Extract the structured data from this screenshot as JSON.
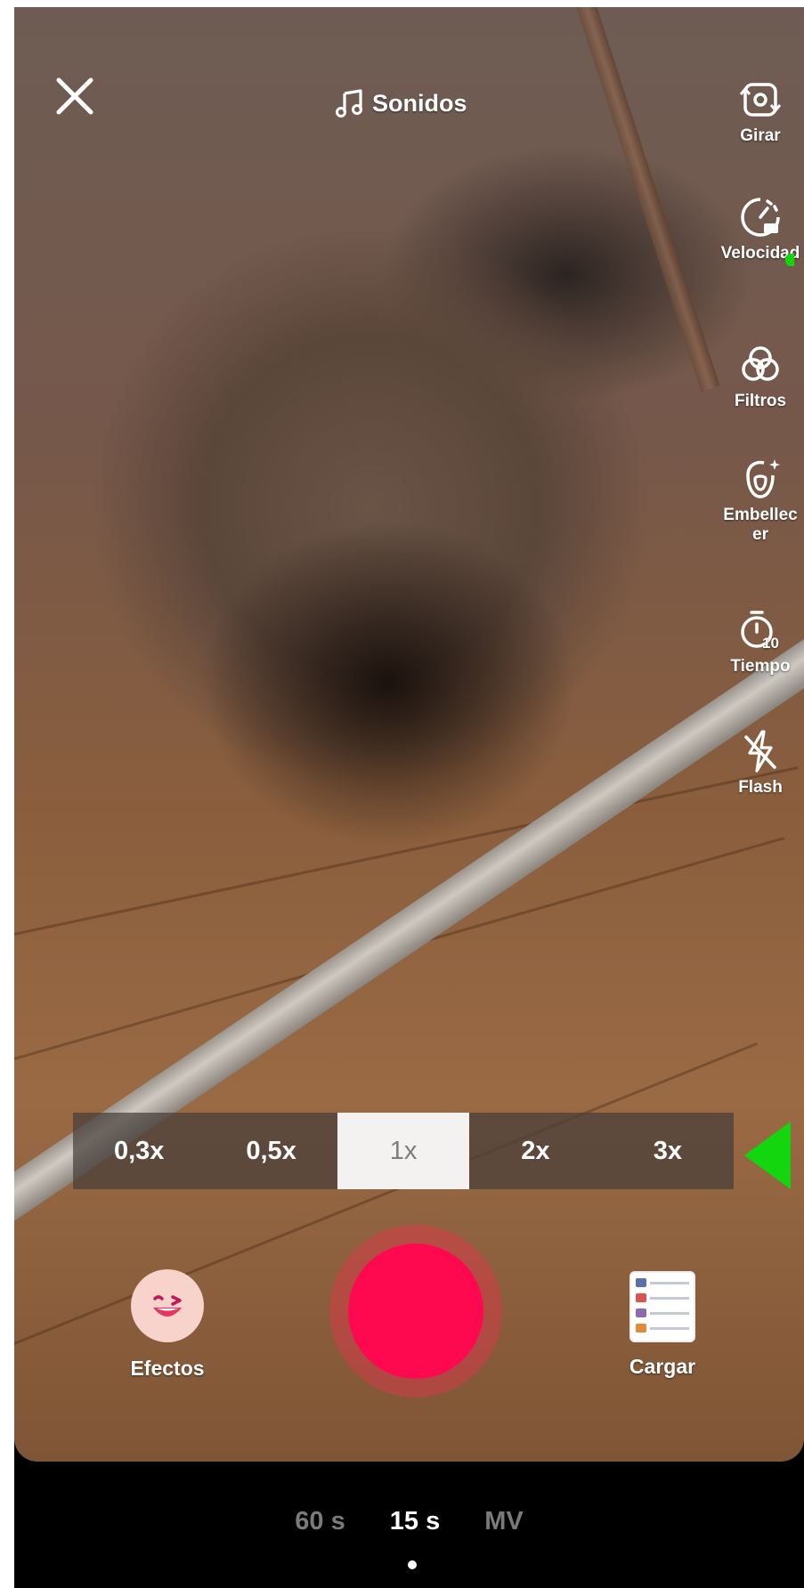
{
  "top_bar": {
    "sound_label": "Sonidos"
  },
  "side_tools": [
    {
      "label": "Girar",
      "icon": "flip-camera-icon"
    },
    {
      "label": "Velocidad",
      "icon": "speed-gauge-icon"
    },
    {
      "label": "Filtros",
      "icon": "filters-icon"
    },
    {
      "label": "Embellecer",
      "icon": "beautify-icon"
    },
    {
      "label": "Tiempo",
      "icon": "timer-10-icon"
    },
    {
      "label": "Flash",
      "icon": "flash-off-icon"
    }
  ],
  "zoom": {
    "options": [
      "0,3x",
      "0,5x",
      "1x",
      "2x",
      "3x"
    ],
    "selected": "1x"
  },
  "bottom_controls": {
    "effects_label": "Efectos",
    "upload_label": "Cargar"
  },
  "duration_tabs": {
    "options": [
      "60 s",
      "15 s",
      "MV"
    ],
    "selected": "15 s"
  },
  "colors": {
    "record": "#fe0950",
    "annotation_arrow": "#13d60e"
  }
}
